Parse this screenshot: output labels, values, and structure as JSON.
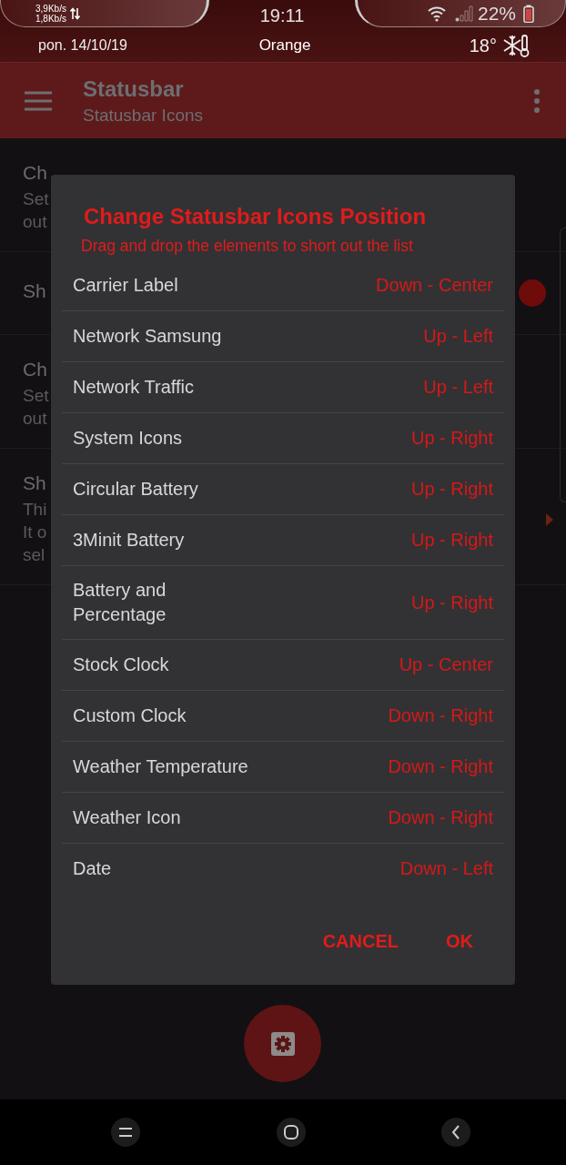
{
  "status_bar": {
    "upload_speed": "3,9Kb/s",
    "download_speed": "1,8Kb/s",
    "time": "19:11",
    "battery": "22%",
    "date": "pon. 14/10/19",
    "carrier": "Orange",
    "temperature": "18°"
  },
  "app_bar": {
    "title": "Statusbar",
    "subtitle": "Statusbar Icons"
  },
  "background_settings": [
    {
      "title": "Ch",
      "summary": [
        "Set",
        "out"
      ]
    },
    {
      "title": "Sh",
      "kind": "switch",
      "on": true
    },
    {
      "title": "Ch",
      "summary": [
        "Set",
        "out"
      ]
    },
    {
      "title": "Sh",
      "summary": [
        "Thi",
        "It o",
        "sel"
      ],
      "kind": "arrow"
    }
  ],
  "dialog": {
    "title": "Change Statusbar Icons Position",
    "subtitle": "Drag and drop the elements to short out the list",
    "items": [
      {
        "label": "Carrier Label",
        "position": "Down - Center"
      },
      {
        "label": "Network Samsung",
        "position": "Up - Left"
      },
      {
        "label": "Network Traffic",
        "position": "Up - Left"
      },
      {
        "label": "System Icons",
        "position": "Up - Right"
      },
      {
        "label": "Circular Battery",
        "position": "Up - Right"
      },
      {
        "label": "3Minit Battery",
        "position": "Up - Right"
      },
      {
        "label": "Battery and\nPercentage",
        "position": "Up - Right"
      },
      {
        "label": "Stock Clock",
        "position": "Up - Center"
      },
      {
        "label": "Custom Clock",
        "position": "Down - Right"
      },
      {
        "label": "Weather Temperature",
        "position": "Down - Right"
      },
      {
        "label": "Weather Icon",
        "position": "Down - Right"
      },
      {
        "label": "Date",
        "position": "Down - Left"
      }
    ],
    "buttons": [
      "CANCEL",
      "OK"
    ]
  }
}
